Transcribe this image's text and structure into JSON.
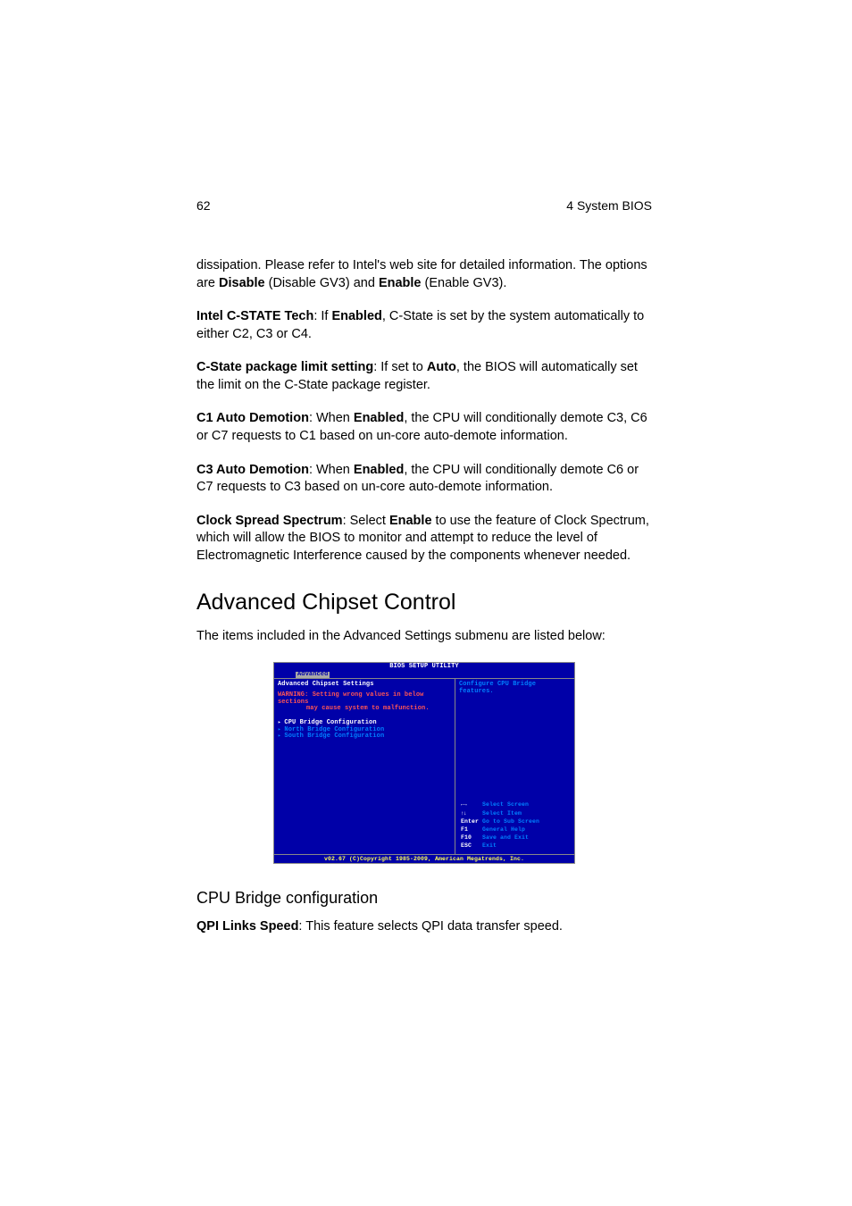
{
  "header": {
    "page_number": "62",
    "section": "4 System BIOS"
  },
  "paragraphs": {
    "p1a": "dissipation.  Please refer to Intel's web site for detailed information. The options are ",
    "p1b": "Disable",
    "p1c": " (Disable GV3) and ",
    "p1d": "Enable",
    "p1e": " (Enable GV3).",
    "p2a": "Intel C-STATE Tech",
    "p2b": ": If ",
    "p2c": "Enabled",
    "p2d": ", C-State is set by the system automatically to either C2, C3 or C4.",
    "p3a": "C-State package limit setting",
    "p3b": ": If set to ",
    "p3c": "Auto",
    "p3d": ", the BIOS will automatically set the limit on the C-State package register.",
    "p4a": "C1 Auto Demotion",
    "p4b": ": When ",
    "p4c": "Enabled",
    "p4d": ", the CPU will conditionally demote C3, C6 or C7 requests to C1 based on un-core auto-demote information.",
    "p5a": "C3 Auto Demotion",
    "p5b": ": When ",
    "p5c": "Enabled",
    "p5d": ", the CPU will conditionally demote C6 or C7 requests to C3 based on un-core auto-demote information.",
    "p6a": "Clock Spread Spectrum",
    "p6b": ": Select ",
    "p6c": "Enable",
    "p6d": " to use the feature of Clock Spectrum, which will allow the BIOS to monitor and attempt to reduce the level of Electromagnetic Interference caused by the components whenever needed."
  },
  "headings": {
    "h2": "Advanced Chipset Control",
    "h2_sub": "The items included in the Advanced Settings submenu are listed below:",
    "h3": "CPU Bridge configuration"
  },
  "last": {
    "a": "QPI Links Speed",
    "b": ": This feature selects QPI data transfer speed."
  },
  "bios": {
    "title": "BIOS SETUP UTILITY",
    "tab": "Advanced",
    "left_title": "Advanced Chipset Settings",
    "warn1": "WARNING: Setting wrong values in below sections",
    "warn2": "may cause system to malfunction.",
    "menu": {
      "m1": "CPU Bridge Configuration",
      "m2": "North Bridge Configuration",
      "m3": "South Bridge Configuration"
    },
    "help1": "Configure CPU Bridge",
    "help2": "features.",
    "keys": {
      "k1a": "←→",
      "k1b": "Select Screen",
      "k2a": "↑↓",
      "k2b": "Select Item",
      "k3a": "Enter",
      "k3b": "Go to Sub Screen",
      "k4a": "F1",
      "k4b": "General Help",
      "k5a": "F10",
      "k5b": "Save and Exit",
      "k6a": "ESC",
      "k6b": "Exit"
    },
    "footer": "v02.67 (C)Copyright 1985-2009, American Megatrends, Inc."
  }
}
